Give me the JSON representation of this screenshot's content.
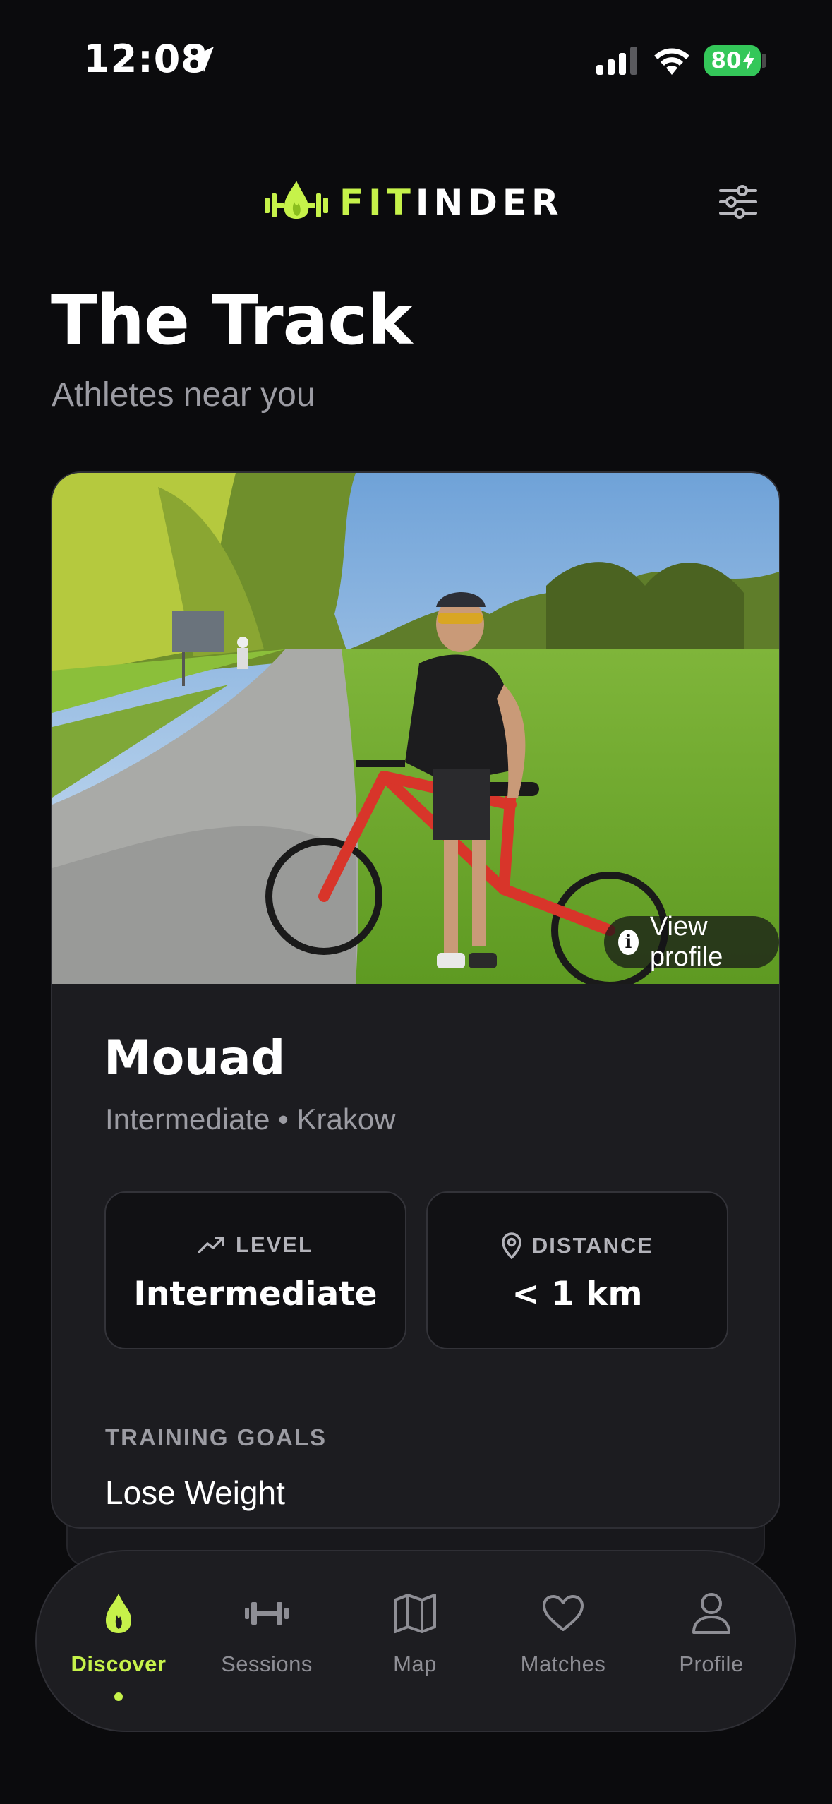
{
  "status_bar": {
    "time": "12:08",
    "battery": "80",
    "icons": [
      "location-arrow-icon",
      "signal-icon",
      "wifi-icon",
      "battery-icon"
    ]
  },
  "header": {
    "brand_accent": "FIT",
    "brand_rest": "INDER",
    "brand_color": "#c6f24a",
    "filter_icon": "sliders-icon"
  },
  "page": {
    "title": "The Track",
    "subtitle": "Athletes near you"
  },
  "card": {
    "view_profile_label": "View profile",
    "name": "Mouad",
    "meta": "Intermediate • Krakow",
    "stats": {
      "level_label": "LEVEL",
      "level_value": "Intermediate",
      "distance_label": "DISTANCE",
      "distance_value": "< 1 km"
    },
    "goals_label": "TRAINING GOALS",
    "goals": [
      "Lose Weight"
    ]
  },
  "nav": {
    "active": "Discover",
    "items": [
      {
        "label": "Discover",
        "icon": "flame-icon"
      },
      {
        "label": "Sessions",
        "icon": "dumbbell-icon"
      },
      {
        "label": "Map",
        "icon": "map-icon"
      },
      {
        "label": "Matches",
        "icon": "heart-icon"
      },
      {
        "label": "Profile",
        "icon": "user-icon"
      }
    ]
  }
}
